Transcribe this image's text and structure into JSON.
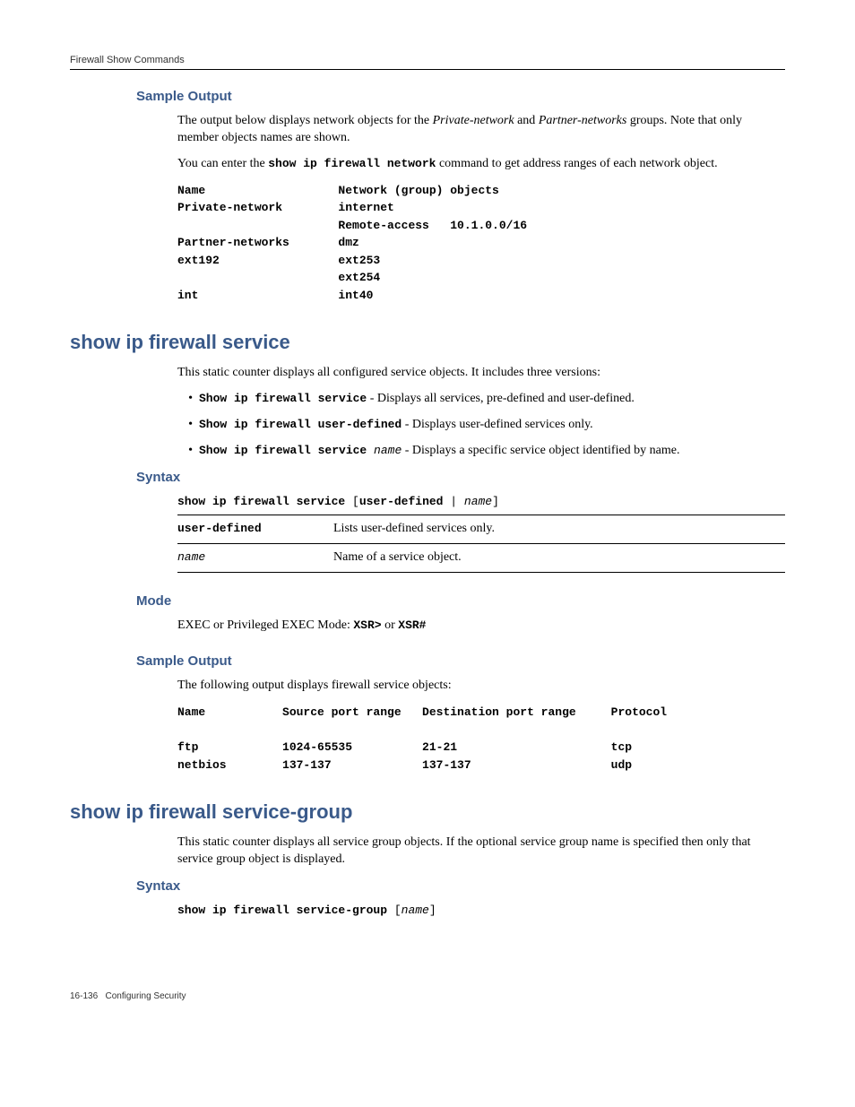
{
  "header": {
    "breadcrumb": "Firewall Show Commands"
  },
  "sec1": {
    "title": "Sample Output",
    "p1a": "The output below displays network objects for the ",
    "p1i1": "Private-network",
    "p1b": " and ",
    "p1i2": "Partner-networks",
    "p1c": " groups. Note that only member objects names are shown.",
    "p2a": "You can enter the ",
    "p2cmd": "show ip firewall network",
    "p2b": " command to get address ranges of each network object.",
    "output": "Name                   Network (group) objects\nPrivate-network        internet\n                       Remote-access   10.1.0.0/16\nPartner-networks       dmz\next192                 ext253\n                       ext254\nint                    int40"
  },
  "sec2": {
    "title": "show ip firewall service",
    "intro": "This static counter displays all configured service objects. It includes three versions:",
    "b1cmd": "Show ip firewall service",
    "b1txt": " - Displays all services, pre-defined and user-defined.",
    "b2cmd": "Show ip firewall user-defined",
    "b2txt": " - Displays user-defined services only.",
    "b3cmd": "Show ip firewall service ",
    "b3name": "name",
    "b3txt": " - Displays a specific service object identified by name.",
    "syntax_h": "Syntax",
    "syntax_line_a": "show ip firewall service ",
    "syntax_line_b": "[",
    "syntax_line_c": "user-defined",
    "syntax_line_d": " | ",
    "syntax_line_e": "name",
    "syntax_line_f": "]",
    "row1k": "user-defined",
    "row1v": "Lists user-defined services only.",
    "row2k": "name",
    "row2v": "Name of a service object.",
    "mode_h": "Mode",
    "mode_a": "EXEC or Privileged EXEC Mode:  ",
    "mode_b": "XSR>",
    "mode_c": " or ",
    "mode_d": "XSR#",
    "sample_h": "Sample Output",
    "sample_intro": "The following output displays firewall service objects:",
    "sample_out": "Name           Source port range   Destination port range     Protocol\n\nftp            1024-65535          21-21                      tcp\nnetbios        137-137             137-137                    udp"
  },
  "sec3": {
    "title": "show ip firewall service-group",
    "intro": "This static counter displays all service group objects. If the optional service group name is specified then only that service group object is displayed.",
    "syntax_h": "Syntax",
    "syn_a": "show ip firewall service-group ",
    "syn_b": "[",
    "syn_c": "name",
    "syn_d": "]"
  },
  "footer": {
    "pg": "16-136",
    "title": "Configuring Security"
  }
}
